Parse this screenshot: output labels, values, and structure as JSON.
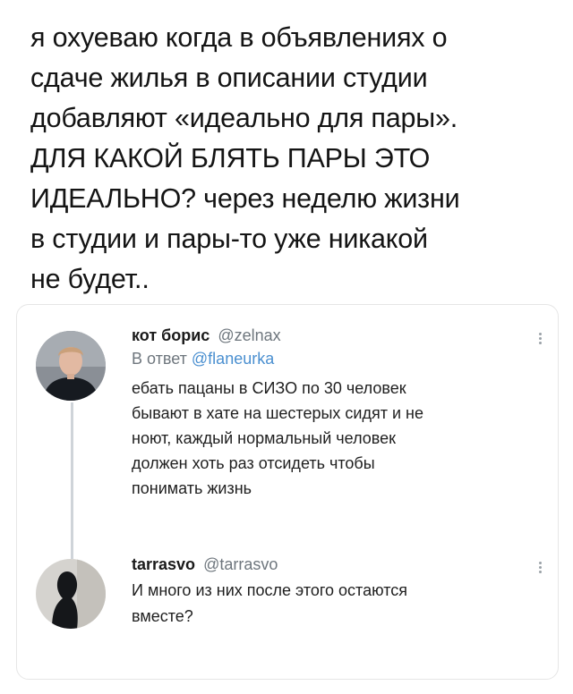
{
  "post": {
    "text": "я охуеваю когда в объявлениях о\nсдаче жилья в описании студии\nдобавляют «идеально для пары».\nДЛЯ КАКОЙ БЛЯТЬ ПАРЫ ЭТО\nИДЕАЛЬНО? через неделю жизни\nв студии и пары-то уже никакой\nне будет.."
  },
  "thread": {
    "tweets": [
      {
        "name": "кот борис",
        "handle": "@zelnax",
        "reply_prefix": "В ответ",
        "reply_handle": "@flaneurka",
        "body": "ебать пацаны в СИЗО по 30 человек\nбывают в хате на шестерых сидят и не\nноют, каждый нормальный человек\nдолжен хоть раз отсидеть чтобы\nпонимать жизнь"
      },
      {
        "name": "tarrasvo",
        "handle": "@tarrasvo",
        "body": "И много из них после этого остаются\nвместе?"
      }
    ]
  },
  "colors": {
    "link": "#4a8fd0",
    "muted": "#6e767d",
    "thread_line": "#cfd4d9",
    "border": "#e6e6e6"
  },
  "icons": [
    "avatar",
    "more-options-icon"
  ]
}
